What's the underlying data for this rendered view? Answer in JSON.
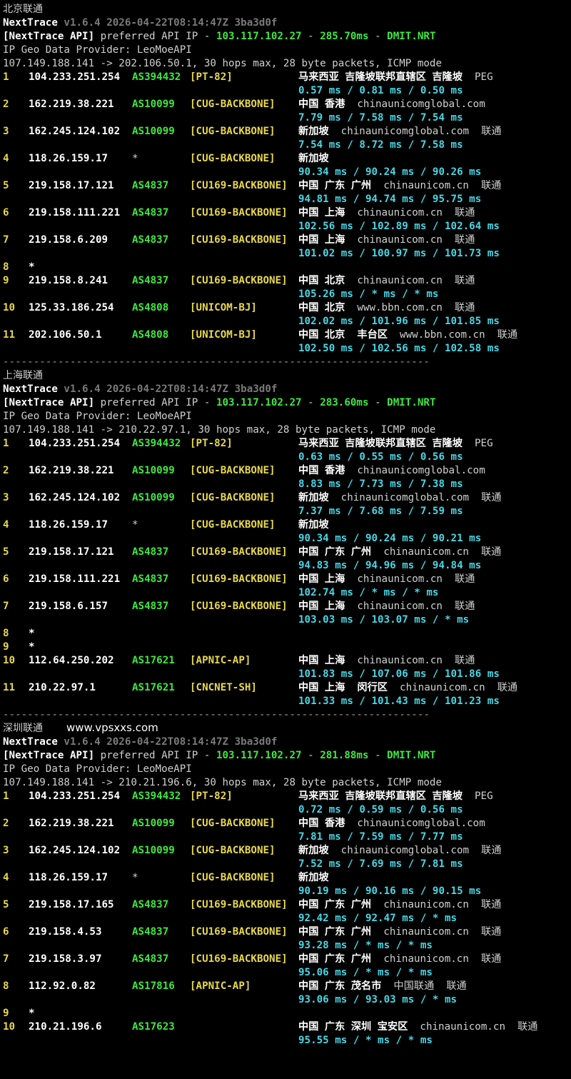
{
  "sections": [
    {
      "title": "北京联通",
      "site": "",
      "nexttrace": {
        "name": "NextTrace",
        "version": "v1.6.4",
        "date": "2026-04-22T08:14:47Z",
        "hash": "3ba3d0f"
      },
      "api": {
        "label": "[NextTrace API]",
        "text1": " preferred API IP - ",
        "ip": "103.117.102.27",
        "dash1": " - ",
        "ms": "285.70ms",
        "dash2": " - ",
        "node": "DMIT.NRT"
      },
      "provider": "IP Geo Data Provider: LeoMoeAPI",
      "route": "107.149.188.141 -> 202.106.50.1, 30 hops max, 28 byte packets, ICMP mode",
      "hops": [
        {
          "n": "1",
          "ip": "104.233.251.254",
          "asn": "AS394432",
          "tag": "[PT-82]",
          "geo": "马来西亚 吉隆坡联邦直辖区 吉隆坡",
          "extra": "PEG",
          "rtt": "0.57 ms / 0.81 ms / 0.50 ms"
        },
        {
          "n": "2",
          "ip": "162.219.38.221",
          "asn": "AS10099",
          "tag": "[CUG-BACKBONE]",
          "geo": "中国 香港",
          "extra": "chinaunicomglobal.com",
          "rtt": "7.79 ms / 7.58 ms / 7.54 ms"
        },
        {
          "n": "3",
          "ip": "162.245.124.102",
          "asn": "AS10099",
          "tag": "[CUG-BACKBONE]",
          "geo": "新加坡",
          "extra": "chinaunicomglobal.com  联通",
          "rtt": "7.54 ms / 8.72 ms / 7.58 ms"
        },
        {
          "n": "4",
          "ip": "118.26.159.17",
          "asn": "*",
          "tag": "[CUG-BACKBONE]",
          "geo": "新加坡",
          "extra": "",
          "rtt": "90.34 ms / 90.24 ms / 90.26 ms"
        },
        {
          "n": "5",
          "ip": "219.158.17.121",
          "asn": "AS4837",
          "tag": "[CU169-BACKBONE]",
          "geo": "中国 广东 广州",
          "extra": "chinaunicom.cn  联通",
          "rtt": "94.81 ms / 94.74 ms / 95.75 ms"
        },
        {
          "n": "6",
          "ip": "219.158.111.221",
          "asn": "AS4837",
          "tag": "[CU169-BACKBONE]",
          "geo": "中国 上海",
          "extra": "chinaunicom.cn  联通",
          "rtt": "102.56 ms / 102.89 ms / 102.64 ms"
        },
        {
          "n": "7",
          "ip": "219.158.6.209",
          "asn": "AS4837",
          "tag": "[CU169-BACKBONE]",
          "geo": "中国 上海",
          "extra": "chinaunicom.cn  联通",
          "rtt": "101.02 ms / 100.97 ms / 101.73 ms"
        },
        {
          "n": "8",
          "ip": "*",
          "asn": "",
          "tag": "",
          "geo": "",
          "extra": "",
          "rtt": ""
        },
        {
          "n": "9",
          "ip": "219.158.8.241",
          "asn": "AS4837",
          "tag": "[CU169-BACKBONE]",
          "geo": "中国 北京",
          "extra": "chinaunicom.cn  联通",
          "rtt": "105.26 ms / * ms / * ms"
        },
        {
          "n": "10",
          "ip": "125.33.186.254",
          "asn": "AS4808",
          "tag": "[UNICOM-BJ]",
          "geo": "中国 北京",
          "extra": "www.bbn.com.cn  联通",
          "rtt": "102.02 ms / 101.96 ms / 101.85 ms"
        },
        {
          "n": "11",
          "ip": "202.106.50.1",
          "asn": "AS4808",
          "tag": "[UNICOM-BJ]",
          "geo": "中国 北京  丰台区",
          "extra": "www.bbn.com.cn  联通",
          "rtt": "102.50 ms / 102.56 ms / 102.58 ms"
        }
      ]
    },
    {
      "title": "上海联通",
      "site": "",
      "nexttrace": {
        "name": "NextTrace",
        "version": "v1.6.4",
        "date": "2026-04-22T08:14:47Z",
        "hash": "3ba3d0f"
      },
      "api": {
        "label": "[NextTrace API]",
        "text1": " preferred API IP - ",
        "ip": "103.117.102.27",
        "dash1": " - ",
        "ms": "283.60ms",
        "dash2": " - ",
        "node": "DMIT.NRT"
      },
      "provider": "IP Geo Data Provider: LeoMoeAPI",
      "route": "107.149.188.141 -> 210.22.97.1, 30 hops max, 28 byte packets, ICMP mode",
      "hops": [
        {
          "n": "1",
          "ip": "104.233.251.254",
          "asn": "AS394432",
          "tag": "[PT-82]",
          "geo": "马来西亚 吉隆坡联邦直辖区 吉隆坡",
          "extra": "PEG",
          "rtt": "0.63 ms / 0.55 ms / 0.56 ms"
        },
        {
          "n": "2",
          "ip": "162.219.38.221",
          "asn": "AS10099",
          "tag": "[CUG-BACKBONE]",
          "geo": "中国 香港",
          "extra": "chinaunicomglobal.com",
          "rtt": "8.83 ms / 7.73 ms / 7.38 ms"
        },
        {
          "n": "3",
          "ip": "162.245.124.102",
          "asn": "AS10099",
          "tag": "[CUG-BACKBONE]",
          "geo": "新加坡",
          "extra": "chinaunicomglobal.com  联通",
          "rtt": "7.37 ms / 7.68 ms / 7.59 ms"
        },
        {
          "n": "4",
          "ip": "118.26.159.17",
          "asn": "*",
          "tag": "[CUG-BACKBONE]",
          "geo": "新加坡",
          "extra": "",
          "rtt": "90.34 ms / 90.24 ms / 90.21 ms"
        },
        {
          "n": "5",
          "ip": "219.158.17.121",
          "asn": "AS4837",
          "tag": "[CU169-BACKBONE]",
          "geo": "中国 广东 广州",
          "extra": "chinaunicom.cn  联通",
          "rtt": "94.83 ms / 94.96 ms / 94.84 ms"
        },
        {
          "n": "6",
          "ip": "219.158.111.221",
          "asn": "AS4837",
          "tag": "[CU169-BACKBONE]",
          "geo": "中国 上海",
          "extra": "chinaunicom.cn  联通",
          "rtt": "102.74 ms / * ms / * ms"
        },
        {
          "n": "7",
          "ip": "219.158.6.157",
          "asn": "AS4837",
          "tag": "[CU169-BACKBONE]",
          "geo": "中国 上海",
          "extra": "chinaunicom.cn  联通",
          "rtt": "103.03 ms / 103.07 ms / * ms"
        },
        {
          "n": "8",
          "ip": "*",
          "asn": "",
          "tag": "",
          "geo": "",
          "extra": "",
          "rtt": ""
        },
        {
          "n": "9",
          "ip": "*",
          "asn": "",
          "tag": "",
          "geo": "",
          "extra": "",
          "rtt": ""
        },
        {
          "n": "10",
          "ip": "112.64.250.202",
          "asn": "AS17621",
          "tag": "[APNIC-AP]",
          "geo": "中国 上海",
          "extra": "chinaunicom.cn  联通",
          "rtt": "101.83 ms / 107.06 ms / 101.86 ms"
        },
        {
          "n": "11",
          "ip": "210.22.97.1",
          "asn": "AS17621",
          "tag": "[CNCNET-SH]",
          "geo": "中国 上海  闵行区",
          "extra": "chinaunicom.cn  联通",
          "rtt": "101.33 ms / 101.43 ms / 101.23 ms"
        }
      ]
    },
    {
      "title": "深圳联通",
      "site": "www.vpsxxs.com",
      "nexttrace": {
        "name": "NextTrace",
        "version": "v1.6.4",
        "date": "2026-04-22T08:14:47Z",
        "hash": "3ba3d0f"
      },
      "api": {
        "label": "[NextTrace API]",
        "text1": " preferred API IP - ",
        "ip": "103.117.102.27",
        "dash1": " - ",
        "ms": "281.88ms",
        "dash2": " - ",
        "node": "DMIT.NRT"
      },
      "provider": "IP Geo Data Provider: LeoMoeAPI",
      "route": "107.149.188.141 -> 210.21.196.6, 30 hops max, 28 byte packets, ICMP mode",
      "hops": [
        {
          "n": "1",
          "ip": "104.233.251.254",
          "asn": "AS394432",
          "tag": "[PT-82]",
          "geo": "马来西亚 吉隆坡联邦直辖区 吉隆坡",
          "extra": "PEG",
          "rtt": "0.72 ms / 0.59 ms / 0.56 ms"
        },
        {
          "n": "2",
          "ip": "162.219.38.221",
          "asn": "AS10099",
          "tag": "[CUG-BACKBONE]",
          "geo": "中国 香港",
          "extra": "chinaunicomglobal.com",
          "rtt": "7.81 ms / 7.59 ms / 7.77 ms"
        },
        {
          "n": "3",
          "ip": "162.245.124.102",
          "asn": "AS10099",
          "tag": "[CUG-BACKBONE]",
          "geo": "新加坡",
          "extra": "chinaunicomglobal.com  联通",
          "rtt": "7.52 ms / 7.69 ms / 7.81 ms"
        },
        {
          "n": "4",
          "ip": "118.26.159.17",
          "asn": "*",
          "tag": "[CUG-BACKBONE]",
          "geo": "新加坡",
          "extra": "",
          "rtt": "90.19 ms / 90.16 ms / 90.15 ms"
        },
        {
          "n": "5",
          "ip": "219.158.17.165",
          "asn": "AS4837",
          "tag": "[CU169-BACKBONE]",
          "geo": "中国 广东 广州",
          "extra": "chinaunicom.cn  联通",
          "rtt": "92.42 ms / 92.47 ms / * ms"
        },
        {
          "n": "6",
          "ip": "219.158.4.53",
          "asn": "AS4837",
          "tag": "[CU169-BACKBONE]",
          "geo": "中国 广东 广州",
          "extra": "chinaunicom.cn  联通",
          "rtt": "93.28 ms / * ms / * ms"
        },
        {
          "n": "7",
          "ip": "219.158.3.97",
          "asn": "AS4837",
          "tag": "[CU169-BACKBONE]",
          "geo": "中国 广东 广州",
          "extra": "chinaunicom.cn  联通",
          "rtt": "95.06 ms / * ms / * ms"
        },
        {
          "n": "8",
          "ip": "112.92.0.82",
          "asn": "AS17816",
          "tag": "[APNIC-AP]",
          "geo": "中国 广东 茂名市",
          "extra": "中国联通  联通",
          "rtt": "93.06 ms / 93.03 ms / * ms"
        },
        {
          "n": "9",
          "ip": "*",
          "asn": "",
          "tag": "",
          "geo": "",
          "extra": "",
          "rtt": ""
        },
        {
          "n": "10",
          "ip": "210.21.196.6",
          "asn": "AS17623",
          "tag": "",
          "geo": "中国 广东 深圳 宝安区",
          "extra": "chinaunicom.cn  联通",
          "rtt": "95.55 ms / * ms / * ms"
        }
      ]
    }
  ],
  "separator": "----------------------------------------------------------------------"
}
